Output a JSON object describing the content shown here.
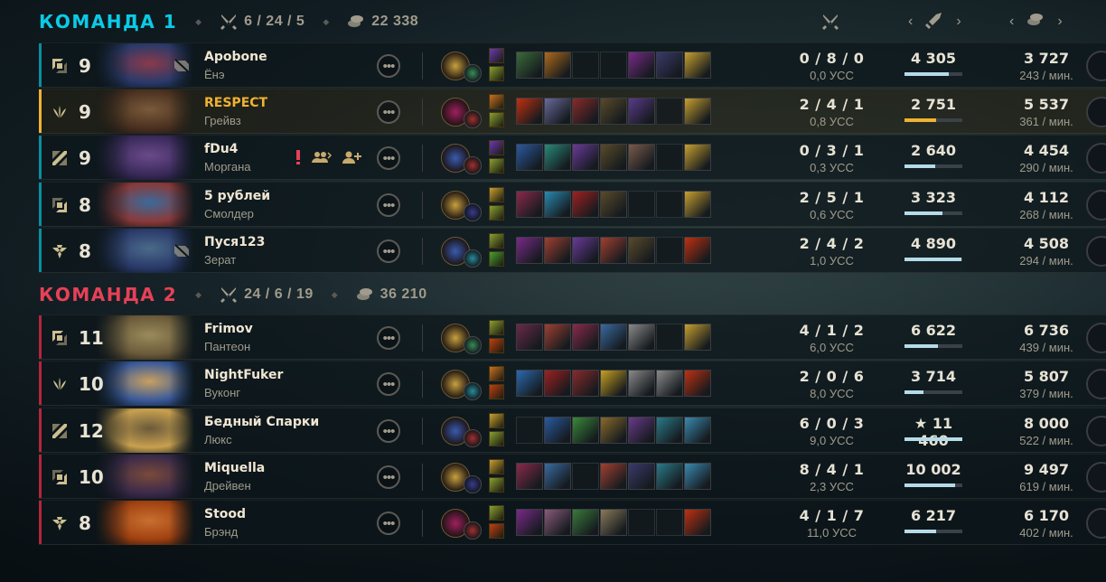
{
  "header_columns": {
    "kda_icon": "crossed-swords-icon",
    "damage_icon": "sword-icon",
    "gold_icon": "coins-icon",
    "prev": "‹",
    "next": "›"
  },
  "teams": [
    {
      "name": "КОМАНДА 1",
      "kda": "6 / 24 / 5",
      "gold": "22 338",
      "color": "#0acbe6",
      "players": [
        {
          "role": "top-icon",
          "level": "9",
          "name": "Apobone",
          "champion": "Ёнэ",
          "muted": true,
          "kda": "0 / 8 / 0",
          "kp": "0,0 УСС",
          "damage": "4 305",
          "damage_share": 0.76,
          "gold": "3 727",
          "gpm": "243 / мин.",
          "bar": "#0a8ea0",
          "items": [
            "#3a6b3a",
            "#b06a1a",
            "",
            "",
            "#7a2a8a",
            "#3a3a6a",
            "#c8a030"
          ],
          "keystone": "#c8a040",
          "secondary": "#3a8a5a",
          "spells": [
            "#6a3ab0",
            "#8aa030"
          ],
          "portrait": [
            "#2a3a6a",
            "#8a3a4a"
          ]
        },
        {
          "role": "jungle-icon",
          "level": "9",
          "name": "RESPECT",
          "champion": "Грейвз",
          "muted": false,
          "kda": "2 / 4 / 1",
          "kp": "0,8 УСС",
          "damage": "2 751",
          "damage_share": 0.55,
          "gold": "5 537",
          "gpm": "361 / мин.",
          "bar": "#f0b232",
          "items": [
            "#c03010",
            "#6a6a9a",
            "#8a2a2a",
            "#5a4a2a",
            "#5a3a8a",
            "",
            "#c8a030"
          ],
          "keystone": "#a02060",
          "secondary": "#a03030",
          "spells": [
            "#c87020",
            "#8aa030"
          ],
          "portrait": [
            "#4a3020",
            "#7a5a3a"
          ]
        },
        {
          "role": "middle-icon",
          "level": "9",
          "name": "fDu4",
          "champion": "Моргана",
          "muted": false,
          "alert": true,
          "kda": "0 / 3 / 1",
          "kp": "0,3 УСС",
          "damage": "2 640",
          "damage_share": 0.53,
          "gold": "4 454",
          "gpm": "290 / мин.",
          "bar": "#0a8ea0",
          "items": [
            "#2a5aa0",
            "#2a8a7a",
            "#6a3a9a",
            "#5a4a2a",
            "#7a5a4a",
            "",
            "#c8a030"
          ],
          "keystone": "#3a5ab0",
          "secondary": "#a03030",
          "spells": [
            "#6a3ab0",
            "#8aa030"
          ],
          "portrait": [
            "#3a2a5a",
            "#6a4a8a"
          ]
        },
        {
          "role": "bottom-icon",
          "level": "8",
          "name": "5 рублей",
          "champion": "Смолдер",
          "muted": false,
          "kda": "2 / 5 / 1",
          "kp": "0,6 УСС",
          "damage": "3 323",
          "damage_share": 0.66,
          "gold": "4 112",
          "gpm": "268 / мин.",
          "bar": "#0a8ea0",
          "items": [
            "#8a2a4a",
            "#2a8ab0",
            "#a02020",
            "#5a4a2a",
            "",
            "",
            "#c8a030"
          ],
          "keystone": "#c8a040",
          "secondary": "#3a3a8a",
          "spells": [
            "#c8a030",
            "#8aa030"
          ],
          "portrait": [
            "#8a3a3a",
            "#3a6a9a"
          ]
        },
        {
          "role": "support-icon",
          "level": "8",
          "name": "Пуся123",
          "champion": "Зерат",
          "muted": true,
          "kda": "2 / 4 / 2",
          "kp": "1,0 УСС",
          "damage": "4 890",
          "damage_share": 0.98,
          "gold": "4 508",
          "gpm": "294 / мин.",
          "bar": "#0a8ea0",
          "items": [
            "#7a2a8a",
            "#a04030",
            "#6a3a9a",
            "#a04030",
            "#5a4a2a",
            "",
            "#c03010"
          ],
          "keystone": "#3a5ab0",
          "secondary": "#2a8a9a",
          "spells": [
            "#8aa030",
            "#4aa030"
          ],
          "portrait": [
            "#2a3a6a",
            "#4a6a8a"
          ]
        }
      ]
    },
    {
      "name": "КОМАНДА 2",
      "kda": "24 / 6 / 19",
      "gold": "36 210",
      "color": "#e84057",
      "players": [
        {
          "role": "top-icon",
          "level": "11",
          "name": "Frimov",
          "champion": "Пантеон",
          "muted": false,
          "kda": "4 / 1 / 2",
          "kp": "6,0 УСС",
          "damage": "6 622",
          "damage_share": 0.58,
          "gold": "6 736",
          "gpm": "439 / мин.",
          "bar": "#b4253c",
          "items": [
            "#6a2a4a",
            "#a04030",
            "#8a2a4a",
            "#3a6aa0",
            "#8a8a8a",
            "",
            "#c8a030"
          ],
          "keystone": "#c8a040",
          "secondary": "#3a8a5a",
          "spells": [
            "#8aa030",
            "#c04010"
          ],
          "portrait": [
            "#6a5a3a",
            "#9a8a5a"
          ]
        },
        {
          "role": "jungle-icon",
          "level": "10",
          "name": "NightFuker",
          "champion": "Вуконг",
          "muted": false,
          "kda": "2 / 0 / 6",
          "kp": "8,0 УСС",
          "damage": "3 714",
          "damage_share": 0.33,
          "gold": "5 807",
          "gpm": "379 / мин.",
          "bar": "#b4253c",
          "items": [
            "#2a6ab0",
            "#a02020",
            "#8a2a2a",
            "#c8a020",
            "#8a8a8a",
            "#8a8a8a",
            "#c03010"
          ],
          "keystone": "#c8a040",
          "secondary": "#2a8a9a",
          "spells": [
            "#c87020",
            "#c04010"
          ],
          "portrait": [
            "#3a5a9a",
            "#c8a060"
          ]
        },
        {
          "role": "middle-icon",
          "level": "12",
          "name": "Бедный Спарки",
          "champion": "Люкс",
          "muted": false,
          "kda": "6 / 0 / 3",
          "kp": "9,0 УСС",
          "damage": "★ 11 460",
          "damage_share": 1.0,
          "gold": "8 000",
          "gpm": "522 / мин.",
          "bar": "#b4253c",
          "items": [
            "",
            "#2a5aa0",
            "#3a8a3a",
            "#8a6a2a",
            "#6a3a8a",
            "#2a7a8a",
            "#3a8ab0"
          ],
          "keystone": "#3a5ab0",
          "secondary": "#a03030",
          "spells": [
            "#c8a030",
            "#8aa030"
          ],
          "portrait": [
            "#c8a050",
            "#6a5a3a"
          ]
        },
        {
          "role": "bottom-icon",
          "level": "10",
          "name": "Miquella",
          "champion": "Дрейвен",
          "muted": false,
          "kda": "8 / 4 / 1",
          "kp": "2,3 УСС",
          "damage": "10 002",
          "damage_share": 0.87,
          "gold": "9 497",
          "gpm": "619 / мин.",
          "bar": "#b4253c",
          "items": [
            "#8a2a4a",
            "#3a6aa0",
            "",
            "#a04030",
            "#3a3a6a",
            "#2a7a8a",
            "#3a8ab0"
          ],
          "keystone": "#c8a040",
          "secondary": "#3a3a8a",
          "spells": [
            "#c8a030",
            "#8aa030"
          ],
          "portrait": [
            "#3a2a4a",
            "#7a4a3a"
          ]
        },
        {
          "role": "support-icon",
          "level": "8",
          "name": "Stood",
          "champion": "Брэнд",
          "muted": false,
          "kda": "4 / 1 / 7",
          "kp": "11,0 УСС",
          "damage": "6 217",
          "damage_share": 0.54,
          "gold": "6 170",
          "gpm": "402 / мин.",
          "bar": "#b4253c",
          "items": [
            "#7a2a8a",
            "#8a5a7a",
            "#3a7a3a",
            "#8a7a5a",
            "",
            "",
            "#c03010"
          ],
          "keystone": "#a02060",
          "secondary": "#a03030",
          "spells": [
            "#8aa030",
            "#c04010"
          ],
          "portrait": [
            "#a04010",
            "#c87030"
          ]
        }
      ]
    }
  ]
}
